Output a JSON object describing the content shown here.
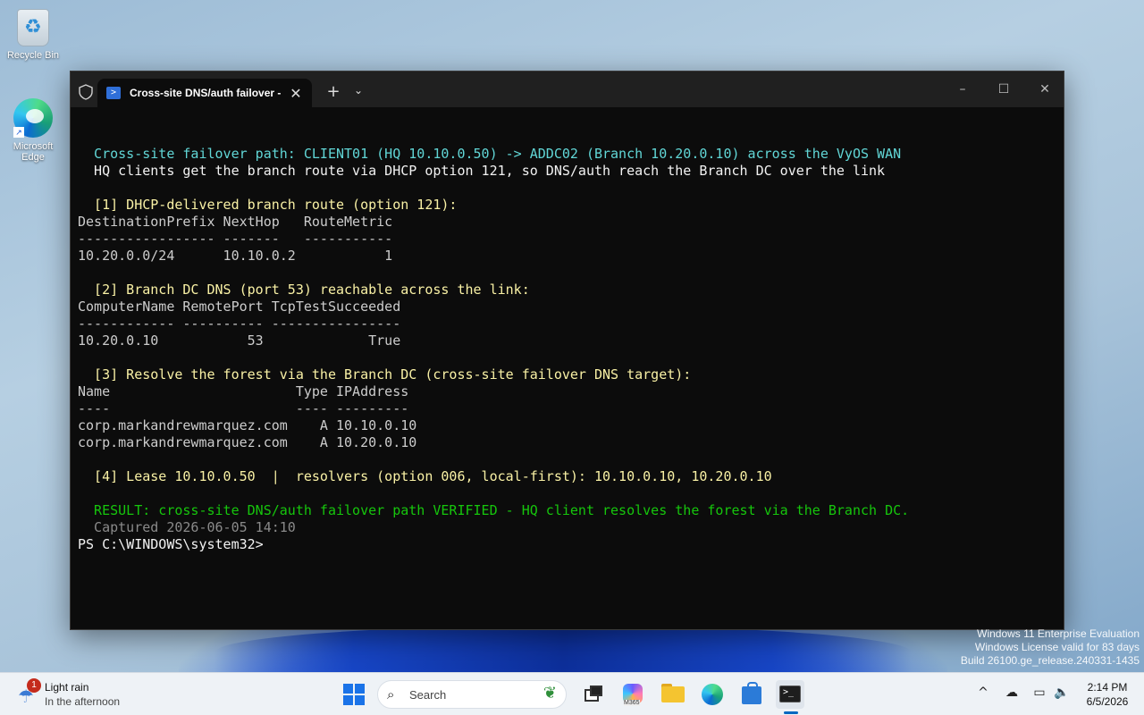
{
  "desktop": {
    "icons": [
      {
        "label": "Recycle Bin",
        "icon": "recycle-bin-icon"
      },
      {
        "label": "Microsoft Edge",
        "icon": "edge-icon"
      }
    ]
  },
  "window": {
    "tab_title": "Cross-site DNS/auth failover -",
    "tab_icon": "powershell-icon",
    "new_tab": "+",
    "dropdown": "⌄",
    "minimize": "–",
    "maximize": "☐",
    "close": "✕"
  },
  "console": {
    "lines": [
      {
        "text": "",
        "color": ""
      },
      {
        "text": "  Cross-site failover path: CLIENT01 (HQ 10.10.0.50) -> ADDC02 (Branch 10.20.0.10) across the VyOS WAN",
        "color": "cyan"
      },
      {
        "text": "  HQ clients get the branch route via DHCP option 121, so DNS/auth reach the Branch DC over the link",
        "color": "white"
      },
      {
        "text": "",
        "color": ""
      },
      {
        "text": "  [1] DHCP-delivered branch route (option 121):",
        "color": "yellow"
      },
      {
        "text": "DestinationPrefix NextHop   RouteMetric",
        "color": ""
      },
      {
        "text": "----------------- -------   -----------",
        "color": ""
      },
      {
        "text": "10.20.0.0/24      10.10.0.2           1",
        "color": ""
      },
      {
        "text": "",
        "color": ""
      },
      {
        "text": "  [2] Branch DC DNS (port 53) reachable across the link:",
        "color": "yellow"
      },
      {
        "text": "ComputerName RemotePort TcpTestSucceeded",
        "color": ""
      },
      {
        "text": "------------ ---------- ----------------",
        "color": ""
      },
      {
        "text": "10.20.0.10           53             True",
        "color": ""
      },
      {
        "text": "",
        "color": ""
      },
      {
        "text": "  [3] Resolve the forest via the Branch DC (cross-site failover DNS target):",
        "color": "yellow"
      },
      {
        "text": "Name                       Type IPAddress",
        "color": ""
      },
      {
        "text": "----                       ---- ---------",
        "color": ""
      },
      {
        "text": "corp.markandrewmarquez.com    A 10.10.0.10",
        "color": ""
      },
      {
        "text": "corp.markandrewmarquez.com    A 10.20.0.10",
        "color": ""
      },
      {
        "text": "",
        "color": ""
      },
      {
        "text": "  [4] Lease 10.10.0.50  |  resolvers (option 006, local-first): 10.10.0.10, 10.20.0.10",
        "color": "yellow"
      },
      {
        "text": "",
        "color": ""
      },
      {
        "text": "  RESULT: cross-site DNS/auth failover path VERIFIED - HQ client resolves the forest via the Branch DC.",
        "color": "green"
      },
      {
        "text": "  Captured 2026-06-05 14:10",
        "color": "gray"
      },
      {
        "text": "PS C:\\WINDOWS\\system32>",
        "color": "white"
      }
    ]
  },
  "watermark": {
    "line1": "Windows 11 Enterprise Evaluation",
    "line2": "Windows License valid for 83 days",
    "line3": "Build 26100.ge_release.240331-1435"
  },
  "taskbar": {
    "weather": {
      "line1": "Light rain",
      "line2": "In the afternoon",
      "badge": "1"
    },
    "search_placeholder": "Search",
    "copilot_badge": "M365",
    "clock": {
      "time": "2:14 PM",
      "date": "6/5/2026"
    }
  }
}
